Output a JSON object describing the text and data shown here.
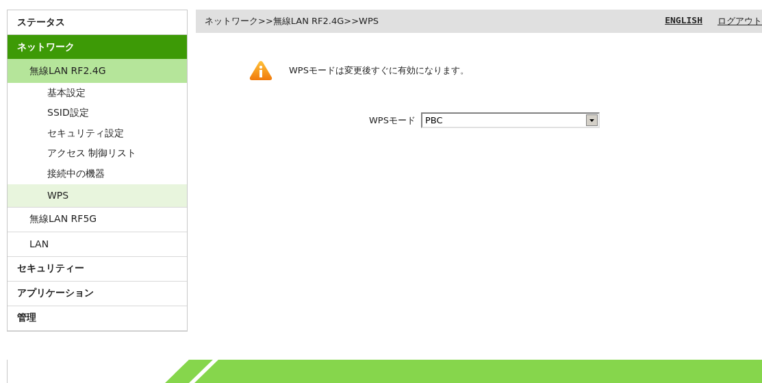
{
  "sidebar": {
    "items": [
      {
        "label": "ステータス",
        "selected": false
      },
      {
        "label": "ネットワーク",
        "selected": true,
        "children": [
          {
            "label": "無線LAN RF2.4G",
            "selected": true,
            "children": [
              {
                "label": "基本設定",
                "selected": false
              },
              {
                "label": "SSID設定",
                "selected": false
              },
              {
                "label": "セキュリティ設定",
                "selected": false
              },
              {
                "label": "アクセス 制御リスト",
                "selected": false
              },
              {
                "label": "接続中の機器",
                "selected": false
              },
              {
                "label": "WPS",
                "selected": true
              }
            ]
          },
          {
            "label": "無線LAN RF5G",
            "selected": false
          },
          {
            "label": "LAN",
            "selected": false
          }
        ]
      },
      {
        "label": "セキュリティー",
        "selected": false
      },
      {
        "label": "アプリケーション",
        "selected": false
      },
      {
        "label": "管理",
        "selected": false
      }
    ]
  },
  "header": {
    "breadcrumb": "ネットワーク>>無線LAN RF2.4G>>WPS",
    "links": [
      "ENGLISH",
      "ログアウト"
    ]
  },
  "notice": "WPSモードは変更後すぐに有効になります。",
  "form": {
    "label": "WPSモード",
    "value": "PBC"
  }
}
